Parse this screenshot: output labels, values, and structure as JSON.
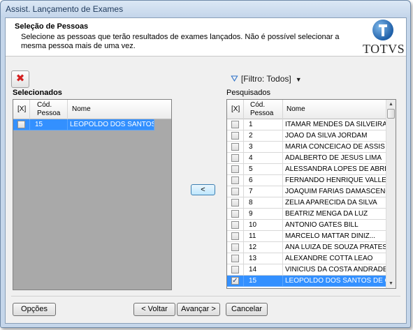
{
  "window": {
    "title": "Assist. Lançamento de Exames"
  },
  "header": {
    "title": "Seleção de Pessoas",
    "description": "Selecione as pessoas que terão resultados de exames lançados. Não é possível selecionar a mesma pessoa mais de uma vez.",
    "logo_text": "TOTVS"
  },
  "toolbar": {
    "clear_icon": "x-icon",
    "clear_symbol": "✖",
    "filter_label": "[Filtro: Todos]",
    "filter_icon": "funnel-icon",
    "filter_arrow": "▼"
  },
  "selected": {
    "label": "Selecionados",
    "columns": {
      "check": "[X]",
      "code_line1": "Cód.",
      "code_line2": "Pessoa",
      "name": "Nome"
    },
    "rows": [
      {
        "checked": false,
        "code": "15",
        "name": "LEOPOLDO DOS SANTOS ..."
      }
    ]
  },
  "search": {
    "label": "Pesquisados",
    "columns": {
      "check": "[X]",
      "code_line1": "Cód.",
      "code_line2": "Pessoa",
      "name": "Nome"
    },
    "rows": [
      {
        "checked": false,
        "code": "1",
        "name": "ITAMAR MENDES DA SILVEIRA"
      },
      {
        "checked": false,
        "code": "2",
        "name": "JOAO DA SILVA JORDAM"
      },
      {
        "checked": false,
        "code": "3",
        "name": "MARIA CONCEICAO DE ASSIS"
      },
      {
        "checked": false,
        "code": "4",
        "name": "ADALBERTO DE JESUS LIMA"
      },
      {
        "checked": false,
        "code": "5",
        "name": "ALESSANDRA LOPES DE ABREU"
      },
      {
        "checked": false,
        "code": "6",
        "name": "FERNANDO HENRIQUE VALLE ..."
      },
      {
        "checked": false,
        "code": "7",
        "name": "JOAQUIM FARIAS DAMASCENO"
      },
      {
        "checked": false,
        "code": "8",
        "name": "ZELIA APARECIDA DA SILVA"
      },
      {
        "checked": false,
        "code": "9",
        "name": "BEATRIZ MENGA DA LUZ"
      },
      {
        "checked": false,
        "code": "10",
        "name": "ANTONIO GATES BILL"
      },
      {
        "checked": false,
        "code": "11",
        "name": "MARCELO MATTAR DINIZ..."
      },
      {
        "checked": false,
        "code": "12",
        "name": "ANA LUIZA  DE SOUZA PRATES"
      },
      {
        "checked": false,
        "code": "13",
        "name": "ALEXANDRE COTTA LEAO"
      },
      {
        "checked": false,
        "code": "14",
        "name": "VINICIUS DA COSTA ANDRADE"
      },
      {
        "checked": true,
        "code": "15",
        "name": "LEOPOLDO DOS SANTOS DE O..."
      }
    ],
    "selected_index": 14
  },
  "move_button": {
    "label": "<"
  },
  "footer": {
    "options": "Opções",
    "back": "< Voltar",
    "next": "Avançar >",
    "cancel": "Cancelar"
  }
}
